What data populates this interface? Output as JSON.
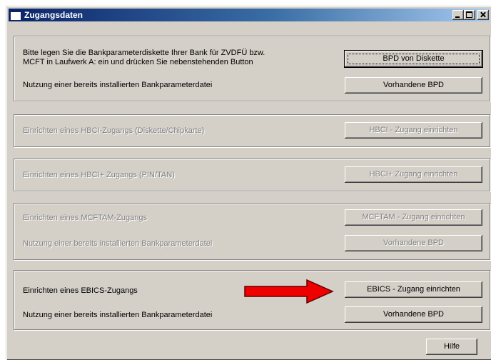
{
  "window": {
    "title": "Zugangsdaten"
  },
  "group1": {
    "row1_line1": "Bitte legen Sie die Bankparameterdiskette Ihrer Bank für ZVDFÜ bzw.",
    "row1_line2": "MCFT in Laufwerk A: ein und drücken Sie nebenstehenden Button",
    "row1_button": "BPD von Diskette",
    "row2_text": "Nutzung einer bereits installierten Bankparameterdatei",
    "row2_button": "Vorhandene BPD"
  },
  "group2": {
    "text": "Einrichten eines HBCI-Zugangs (Diskette/Chipkarte)",
    "button": "HBCI - Zugang einrichten"
  },
  "group3": {
    "text": "Einrichten eines HBCI+ Zugangs (PIN/TAN)",
    "button": "HBCI+ Zugang einrichten"
  },
  "group4": {
    "row1_text": "Einrichten eines MCFTAM-Zugangs",
    "row1_button": "MCFTAM - Zugang einrichten",
    "row2_text": "Nutzung einer bereits installierten Bankparameterdatei",
    "row2_button": "Vorhandene BPD"
  },
  "group5": {
    "row1_text": "Einrichten eines EBICS-Zugangs",
    "row1_button": "EBICS - Zugang einrichten",
    "row2_text": "Nutzung einer bereits installierten Bankparameterdatei",
    "row2_button": "Vorhandene BPD"
  },
  "footer": {
    "help_button": "Hilfe"
  },
  "colors": {
    "titlebar_start": "#0a246a",
    "titlebar_end": "#a6caf0",
    "face": "#d4d0c8",
    "disabled_text": "#808080",
    "arrow": "#ee0000"
  },
  "icons": [
    "window-app-icon",
    "minimize-icon",
    "maximize-icon",
    "close-icon",
    "red-arrow-icon"
  ]
}
